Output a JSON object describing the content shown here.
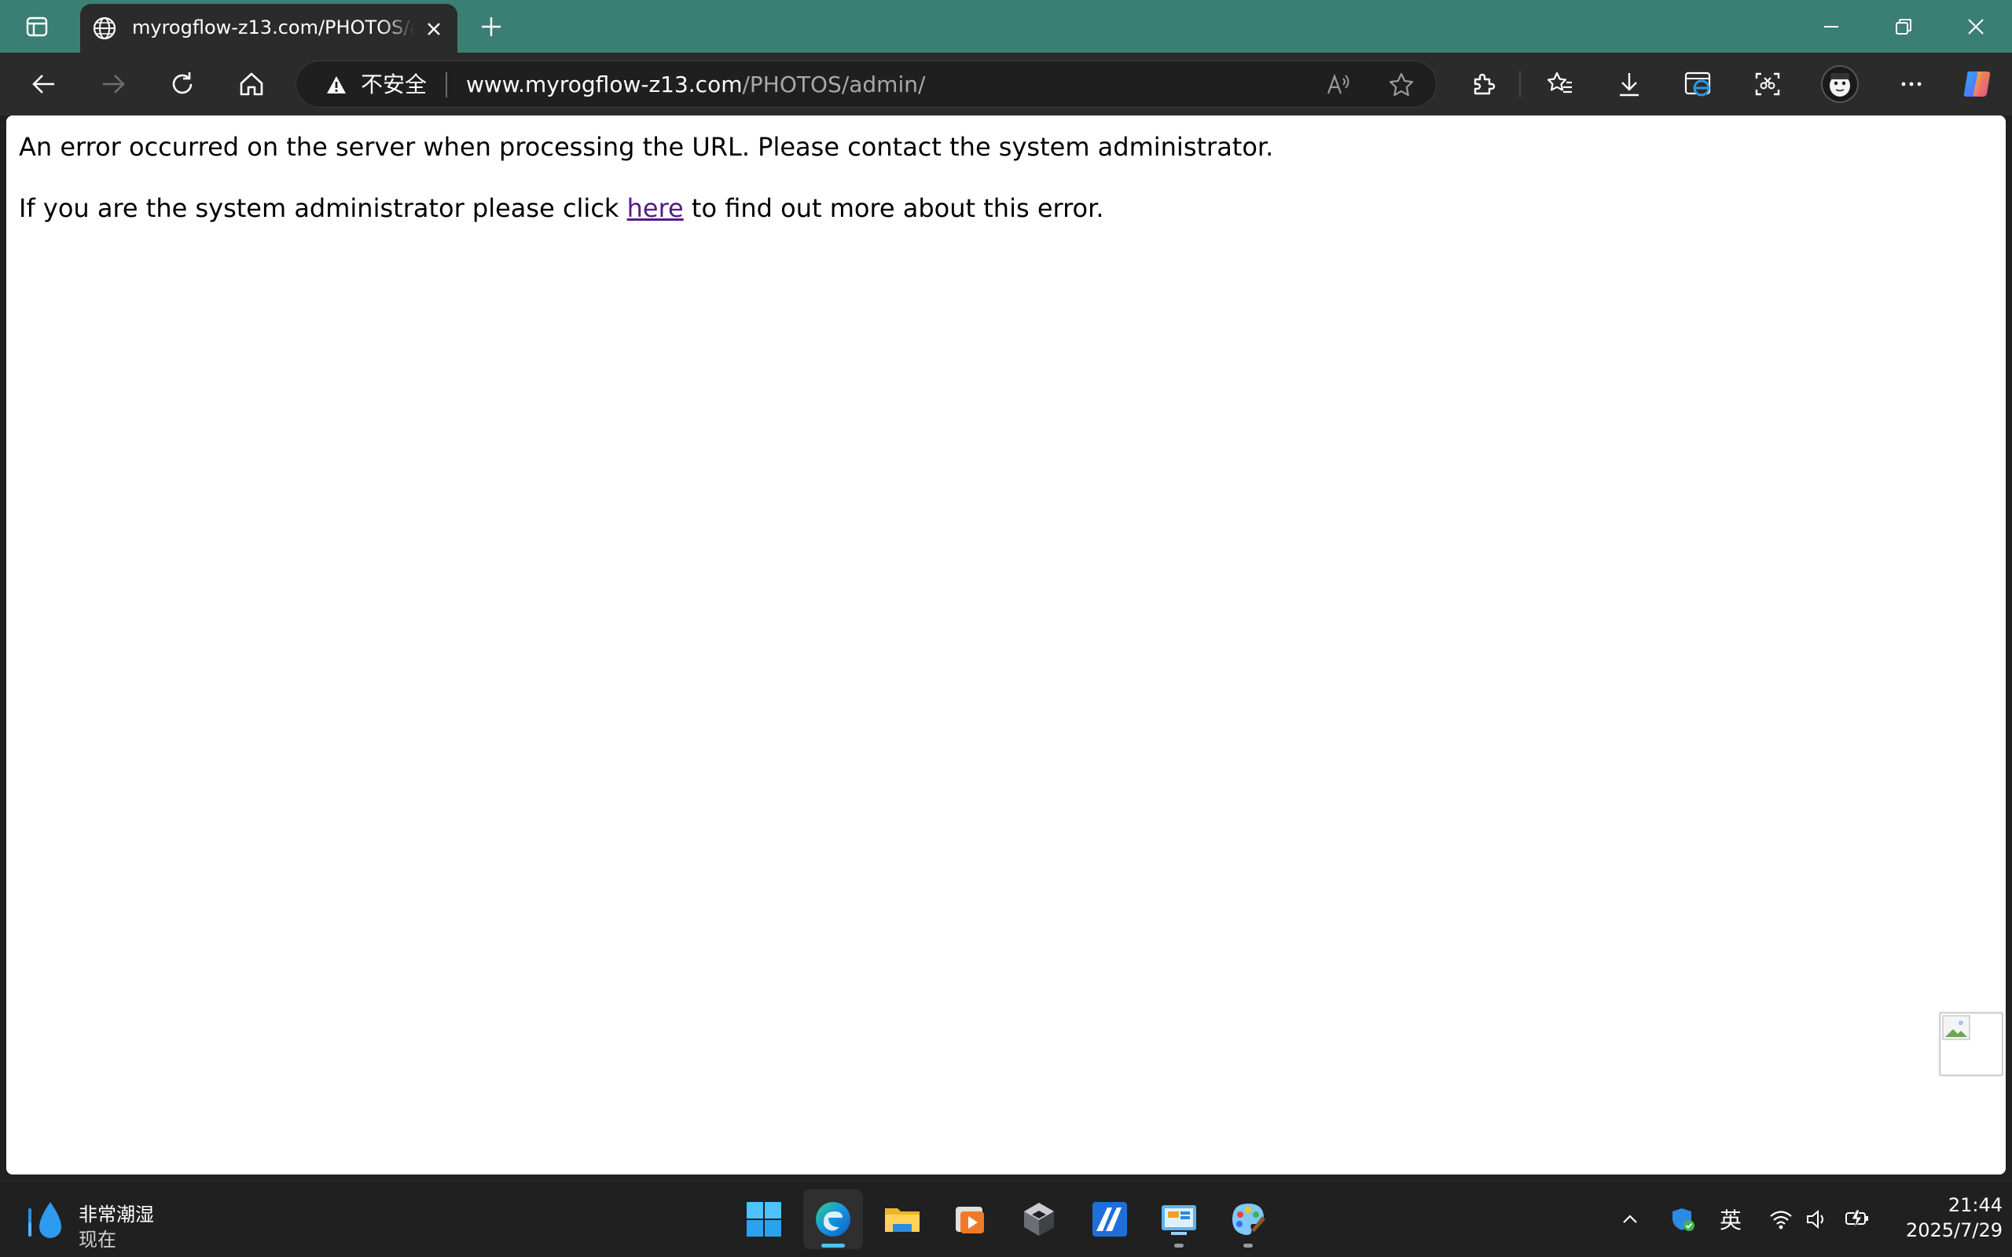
{
  "browser": {
    "tab": {
      "title": "myrogflow-z13.com/PHOTOS/admin/"
    },
    "omnibox": {
      "security_label": "不安全",
      "url_host": "www.myrogflow-z13.com",
      "url_path": "/PHOTOS/admin/"
    },
    "colors": {
      "tabstrip": "#3b7f74",
      "toolbar": "#2b2b2b",
      "link_visited": "#551a8b"
    }
  },
  "page": {
    "line1": "An error occurred on the server when processing the URL. Please contact the system administrator.",
    "line2_before": "If you are the system administrator please click ",
    "line2_link": "here",
    "line2_after": " to find out more about this error."
  },
  "taskbar": {
    "weather": {
      "condition": "非常潮湿",
      "time": "现在"
    },
    "apps": [
      "start-icon",
      "edge-icon",
      "file-explorer-icon",
      "media-player-icon",
      "3d-app-icon",
      "autodesk-icon",
      "control-panel-icon",
      "paint-icon"
    ],
    "tray": {
      "ime": "英"
    },
    "clock": {
      "time": "21:44",
      "date": "2025/7/29"
    }
  }
}
